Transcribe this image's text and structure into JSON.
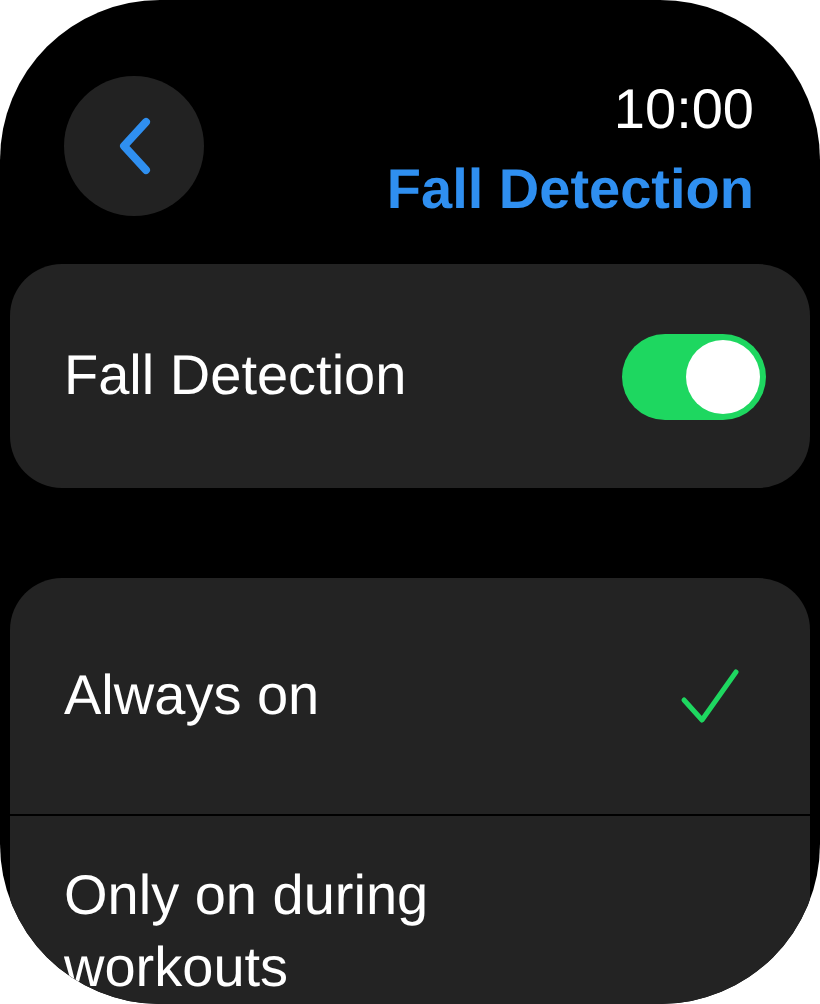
{
  "status_bar": {
    "time": "10:00"
  },
  "header": {
    "title": "Fall Detection"
  },
  "toggle": {
    "label": "Fall Detection",
    "on": true
  },
  "options": [
    {
      "label": "Always on",
      "selected": true
    },
    {
      "label": "Only on during workouts",
      "selected": false
    }
  ]
}
